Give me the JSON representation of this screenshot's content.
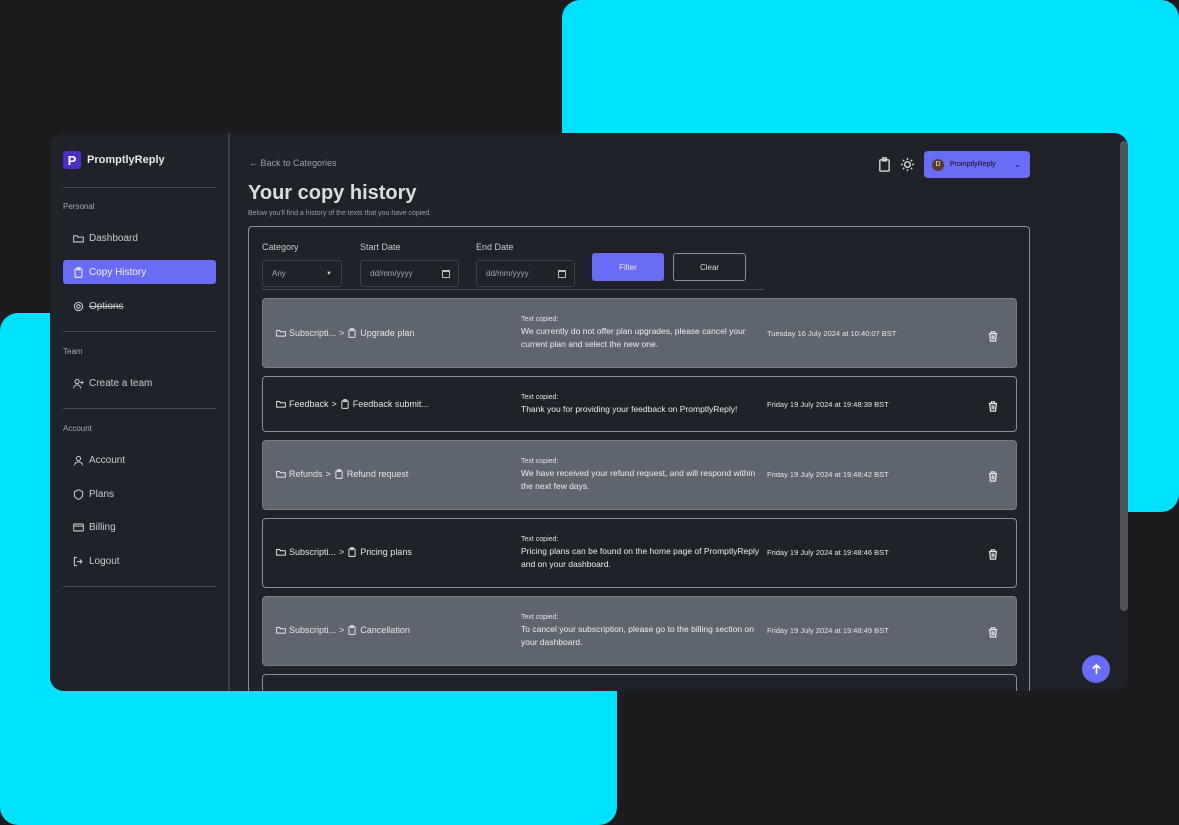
{
  "app": {
    "brand_letter": "P",
    "brand_name": "PromptlyReply"
  },
  "sidebar": {
    "sections": [
      {
        "label": "Personal"
      },
      {
        "label": "Team"
      },
      {
        "label": "Account"
      }
    ],
    "items": [
      {
        "label": "Dashboard",
        "icon": "folder-icon"
      },
      {
        "label": "Copy History",
        "icon": "clipboard-icon",
        "active": true
      },
      {
        "label": "Options",
        "icon": "gear-icon"
      },
      {
        "label": "Create a team",
        "icon": "user-plus-icon"
      },
      {
        "label": "Account",
        "icon": "user-icon"
      },
      {
        "label": "Plans",
        "icon": "badge-icon"
      },
      {
        "label": "Billing",
        "icon": "credit-card-icon"
      },
      {
        "label": "Logout",
        "icon": "logout-icon"
      }
    ]
  },
  "header": {
    "back_link": "← Back to Categories",
    "title": "Your copy history",
    "subtitle": "Below you'll find a history of the texts that you have copied.",
    "user_initial": "D",
    "user_name": "PromptlyReply",
    "user_chevron": "⌄"
  },
  "filters": {
    "category_label": "Category",
    "category_value": "Any",
    "start_label": "Start Date",
    "start_placeholder": "dd/mm/yyyy",
    "end_label": "End Date",
    "end_placeholder": "dd/mm/yyyy",
    "filter_button": "Filter",
    "clear_button": "Clear"
  },
  "history": {
    "copied_label": "Text copied:",
    "separator": ">",
    "rows": [
      {
        "category": "Subscripti...",
        "item": "Upgrade plan",
        "text": "We currently do not offer plan upgrades, please cancel your current plan and select the new one.",
        "date": "Tuesday 16 July 2024 at 10:40:07 BST"
      },
      {
        "category": "Feedback",
        "item": "Feedback submit...",
        "text": "Thank you for providing your feedback on PromptlyReply!",
        "date": "Friday 19 July 2024 at 19:48:39 BST"
      },
      {
        "category": "Refunds",
        "item": "Refund request",
        "text": "We have received your refund request, and will respond within the next few days.",
        "date": "Friday 19 July 2024 at 19:48:42 BST"
      },
      {
        "category": "Subscripti...",
        "item": "Pricing plans",
        "text": "Pricing plans can be found on the home page of PromptlyReply and on your dashboard.",
        "date": "Friday 19 July 2024 at 19:48:46 BST"
      },
      {
        "category": "Subscripti...",
        "item": "Cancellation",
        "text": "To cancel your subscription, please go to the billing section on your dashboard.",
        "date": "Friday 19 July 2024 at 19:48:49 BST"
      }
    ]
  },
  "colors": {
    "accent": "#6a6cf5",
    "background_accent": "#00e1ff",
    "window_bg": "#1f2228",
    "row_shaded": "#5f6570"
  }
}
